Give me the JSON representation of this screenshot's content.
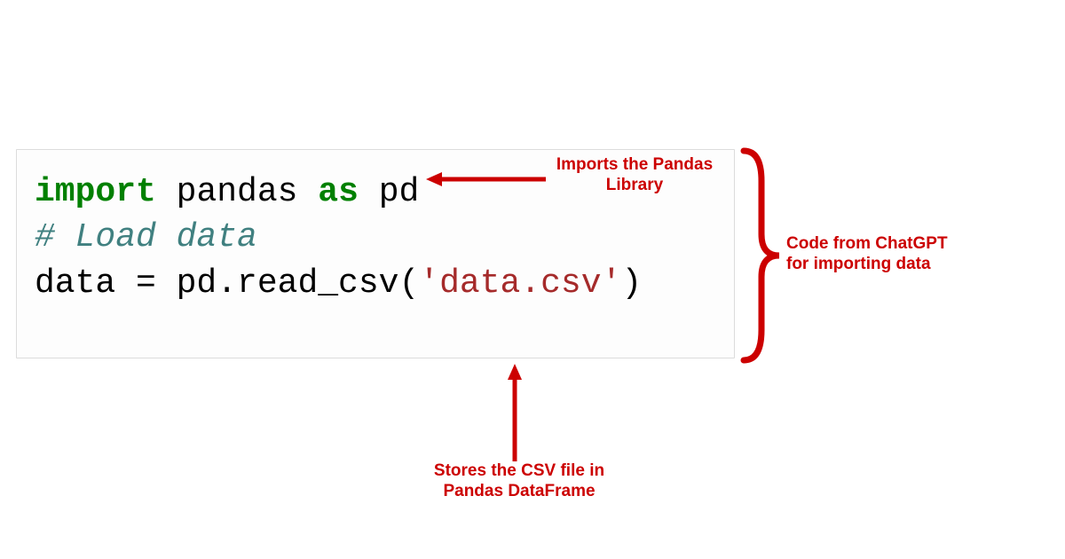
{
  "code": {
    "line1_import": "import",
    "line1_space1": " ",
    "line1_pandas": "pandas",
    "line1_space2": " ",
    "line1_as": "as",
    "line1_space3": " ",
    "line1_pd": "pd",
    "line_blank": "",
    "line3_comment": "# Load data",
    "line4_pre": "data = pd.read_csv(",
    "line4_str": "'data.csv'",
    "line4_post": ")"
  },
  "annotations": {
    "top_right": "Imports the Pandas Library",
    "bottom": "Stores the CSV file in Pandas DataFrame",
    "brace": "Code from ChatGPT for importing data"
  }
}
